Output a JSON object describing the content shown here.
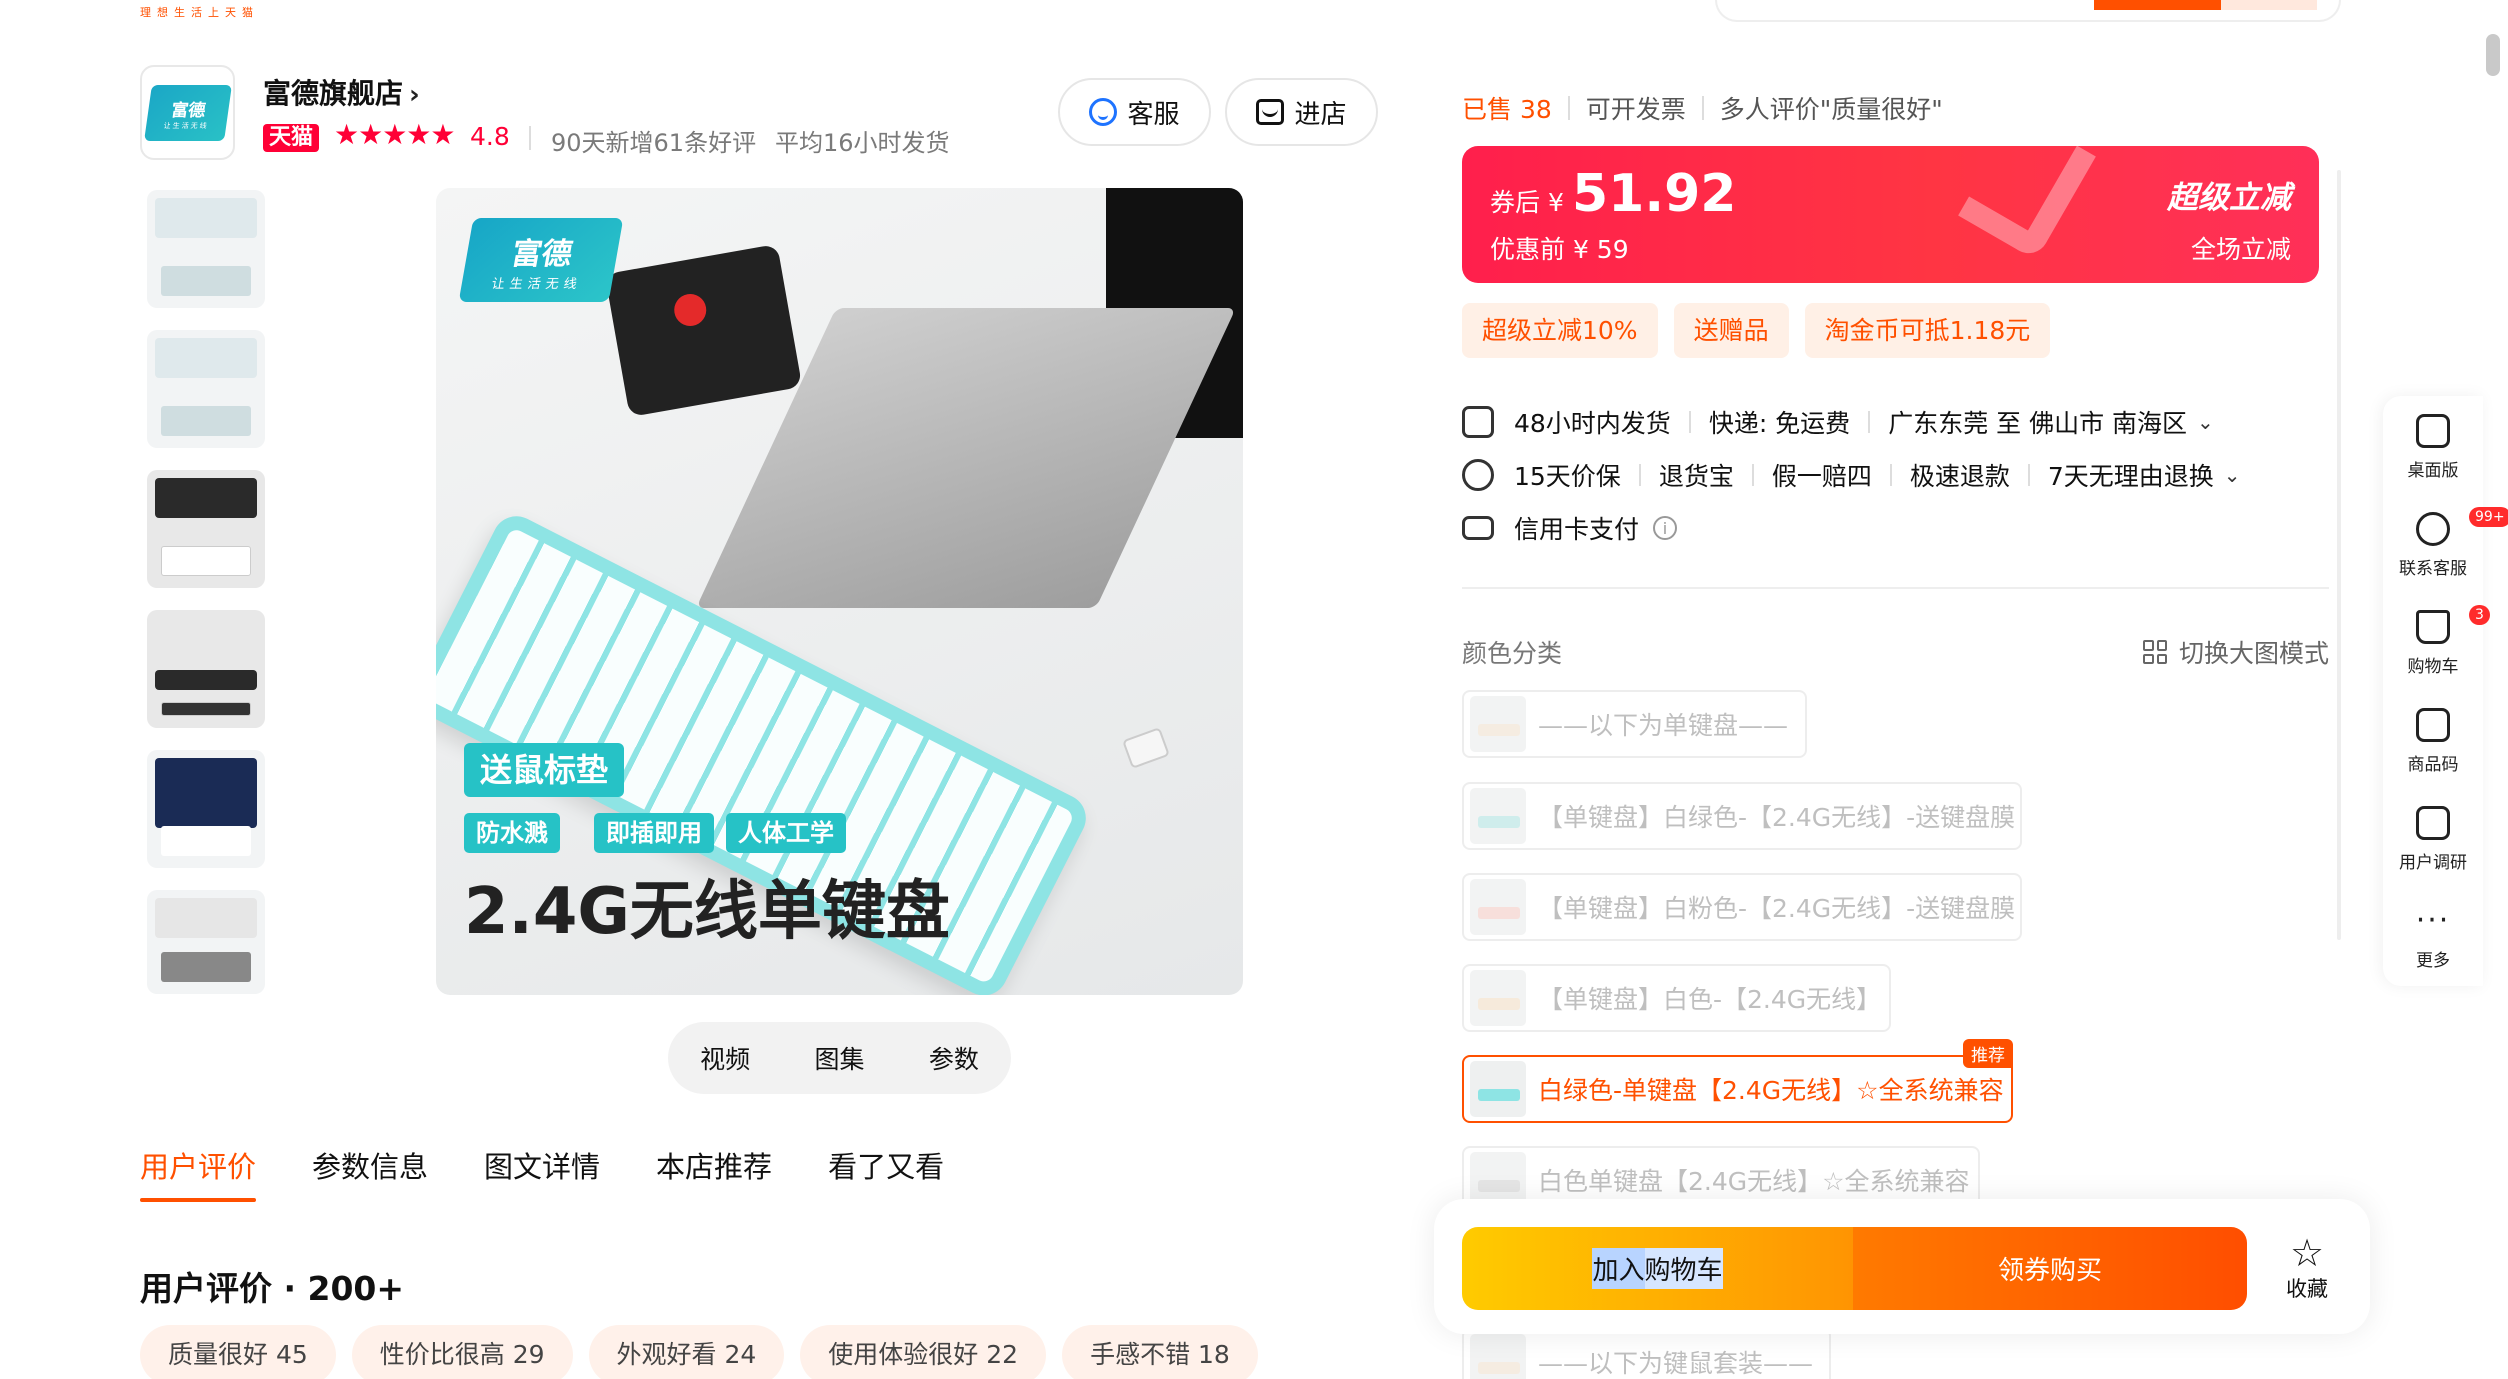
{
  "tagline": "理想生活上天猫",
  "shop": {
    "logo_text": "富德",
    "logo_sub": "让生活无线",
    "name": "富德旗舰店",
    "tmall": "天猫",
    "stars": "★★★★★",
    "rating": "4.8",
    "stat1": "90天新增61条好评",
    "stat2": "平均16小时发货",
    "service_label": "客服",
    "store_label": "进店"
  },
  "gallery": {
    "brand": "富德",
    "brand_sub": "让生活无线",
    "promo_main": "送鼠标垫",
    "promo_tags": [
      "防水溅",
      "即插即用",
      "人体工学"
    ],
    "headline": "2.4G无线单键盘"
  },
  "media_tabs": [
    "视频",
    "图集",
    "参数"
  ],
  "nav_tabs": [
    "用户评价",
    "参数信息",
    "图文详情",
    "本店推荐",
    "看了又看"
  ],
  "reviews": {
    "title": "用户评价 · 200+",
    "tags": [
      "质量很好 45",
      "性价比很高 29",
      "外观好看 24",
      "使用体验很好 22",
      "手感不错 18"
    ]
  },
  "product": {
    "sold": "已售 38",
    "invoice": "可开发票",
    "praise": "多人评价\"质量很好\"",
    "price_label": "券后 ¥",
    "price": "51.92",
    "price_before": "优惠前 ¥ 59",
    "promo_title": "超级立减",
    "promo_sub": "全场立减",
    "benefits": [
      "超级立减10%",
      "送赠品",
      "淘金币可抵1.18元"
    ],
    "shipping": [
      "48小时内发货",
      "快递: 免运费",
      "广东东莞 至 佛山市 南海区"
    ],
    "guarantees": [
      "15天价保",
      "退货宝",
      "假一赔四",
      "极速退款",
      "7天无理由退换"
    ],
    "payment": "信用卡支付",
    "color_label": "颜色分类",
    "switch_mode": "切换大图模式",
    "skus": [
      "——以下为单键盘——",
      "【单键盘】白绿色-【2.4G无线】-送键盘膜",
      "【单键盘】白粉色-【2.4G无线】-送键盘膜",
      "【单键盘】白色-【2.4G无线】",
      "白绿色-单键盘【2.4G无线】☆全系统兼容",
      "白色单键盘【2.4G无线】☆全系统兼容",
      "——以下为键鼠套装——"
    ],
    "recommend_badge": "推荐"
  },
  "actions": {
    "cart_highlight": "加入",
    "cart_rest": "购物车",
    "buy": "领券购买",
    "favorite": "收藏"
  },
  "side_rail": {
    "desktop": "桌面版",
    "service": "联系客服",
    "service_badge": "99+",
    "cart": "购物车",
    "cart_badge": "3",
    "qrcode": "商品码",
    "survey": "用户调研",
    "more": "更多"
  },
  "colors": {
    "accent": "#ff5000",
    "price_red": "#ff2b4a",
    "tmall_red": "#ff0036",
    "teal": "#26c2c6"
  }
}
